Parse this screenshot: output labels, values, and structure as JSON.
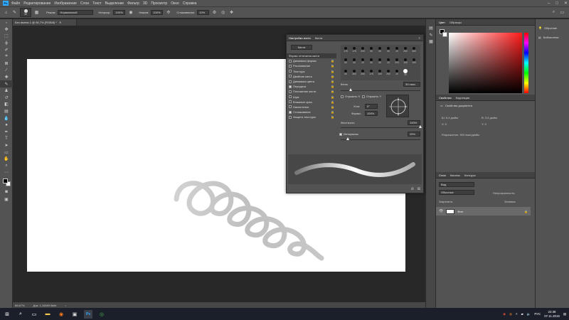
{
  "app": {
    "logo": "Ps"
  },
  "menu": [
    "Файл",
    "Редактирование",
    "Изображение",
    "Слои",
    "Текст",
    "Выделение",
    "Фильтр",
    "3D",
    "Просмотр",
    "Окно",
    "Справка"
  ],
  "options": {
    "brush_size": "30",
    "mode_label": "Режим:",
    "mode_value": "Нормальный",
    "opacity_label": "Непрозр.:",
    "opacity_value": "100%",
    "flow_label": "Нажим:",
    "flow_value": "100%",
    "smoothing_label": "Сглаживание:",
    "smoothing_value": "10%"
  },
  "document": {
    "tab_title": "Без имени-1 @ 66,7% (RGB/8) *",
    "zoom": "66,67%",
    "doc_info": "Док: 1,10M/0 байт"
  },
  "brush_panel": {
    "tabs": [
      "Настройки кисти",
      "Кисти"
    ],
    "brushes_button": "Кисти",
    "sections": [
      {
        "label": "Форма отпечатка кисти",
        "checked": null
      },
      {
        "label": "Динамика формы",
        "checked": false
      },
      {
        "label": "Рассеивание",
        "checked": false
      },
      {
        "label": "Текстура",
        "checked": false
      },
      {
        "label": "Двойная кисть",
        "checked": false
      },
      {
        "label": "Динамика цвета",
        "checked": false
      },
      {
        "label": "Передача",
        "checked": true
      },
      {
        "label": "Положение кисти",
        "checked": false
      },
      {
        "label": "Шум",
        "checked": false
      },
      {
        "label": "Влажные края",
        "checked": false
      },
      {
        "label": "Накопление",
        "checked": false
      },
      {
        "label": "Сглаживание",
        "checked": true
      },
      {
        "label": "Защита текстуры",
        "checked": false
      }
    ],
    "tip_row1": [
      "175",
      "175",
      "200",
      "30",
      "30",
      "30",
      "20",
      "200"
    ],
    "tip_row2": [
      "400",
      "50",
      "40",
      "20",
      "30",
      "30",
      "20",
      "200"
    ],
    "tip_row3": [
      "100",
      "100",
      "30",
      "300",
      "250",
      "175",
      "100",
      "200"
    ],
    "tip_row4": [
      "20",
      "30"
    ],
    "size_label": "Кегль",
    "size_value": "30 пикс.",
    "flip_x": "Отразить X",
    "flip_y": "Отразить Y",
    "angle_label": "Угол:",
    "angle_value": "0°",
    "roundness_label": "Форма:",
    "roundness_value": "100%",
    "hardness_label": "Жесткость",
    "hardness_value": "100%",
    "spacing_label": "Интервалы",
    "spacing_value": "25%"
  },
  "right_panels": {
    "color_tabs": [
      "Цвет",
      "Образцы"
    ],
    "props_tabs": [
      "Свойства",
      "Коррекция"
    ],
    "props_title": "Свойства документа",
    "props_w": "Ш: 6,4 дюйм",
    "props_h": "В: 3,6 дюйм",
    "props_x": "X: 0",
    "props_y": "Y: 0",
    "resolution": "Разрешение: 300 пикс/дюйм",
    "layer_tabs": [
      "Слои",
      "Каналы",
      "Контуры"
    ],
    "layer_kind": "Вид",
    "blend_mode": "Обычные",
    "opacity_label": "Непрозрачность:",
    "lock_label": "Закрепить:",
    "fill_label": "Заливка:",
    "layer_name": "Фон"
  },
  "far_right": {
    "learn": "Обучение",
    "libraries": "Библиотеки"
  },
  "taskbar": {
    "lang": "РУС",
    "time": "22:38",
    "date": "07.11.2019"
  }
}
